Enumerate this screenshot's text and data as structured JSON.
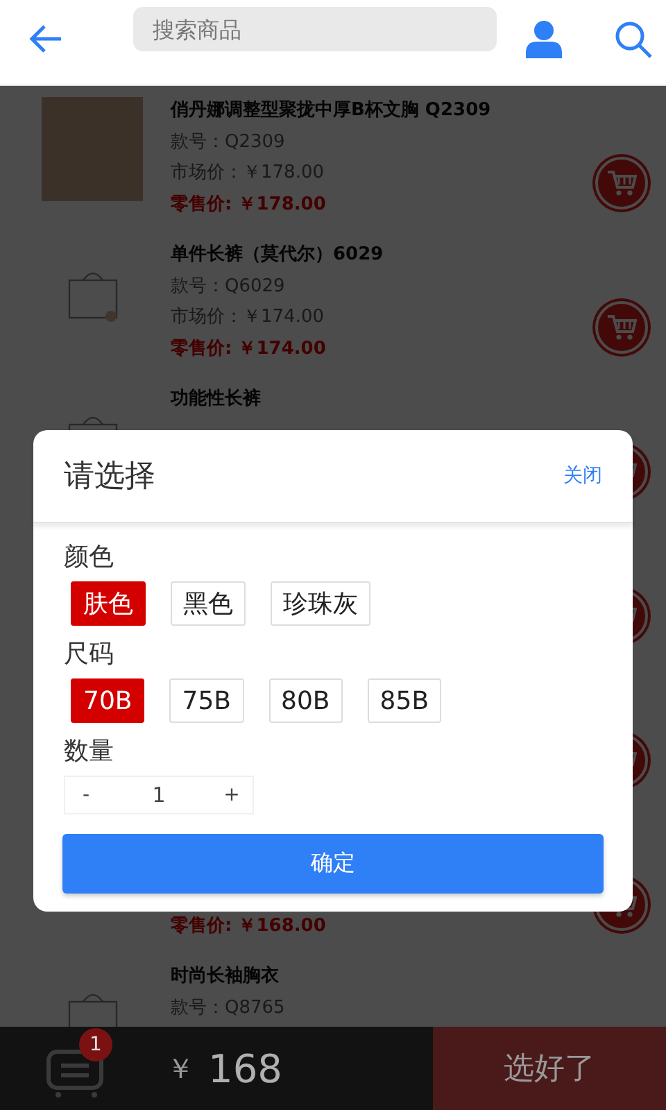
{
  "header": {
    "search": {
      "placeholder": "搜索商品"
    }
  },
  "products": [
    {
      "kind": "photo",
      "title": "俏丹娜调整型聚拢中厚B杯文胸 Q2309",
      "style_no": "款号：Q2309",
      "market_price": "市场价：￥178.00",
      "retail_price": "零售价: ￥178.00",
      "cart_button": true
    },
    {
      "kind": "bag",
      "title": "单件长裤（莫代尔）6029",
      "style_no": "款号：Q6029",
      "market_price": "市场价：￥174.00",
      "retail_price": "零售价: ￥174.00",
      "cart_button": true
    },
    {
      "kind": "bag",
      "title": "功能性长裤",
      "cart_button": true
    },
    {
      "kind": "none",
      "cart_button": true
    },
    {
      "kind": "none",
      "cart_button": true
    },
    {
      "kind": "none",
      "retail_price": "零售价: ￥168.00",
      "cart_button": true
    },
    {
      "kind": "bag",
      "title": "时尚长袖胸衣",
      "style_no": "款号：Q8765",
      "cart_button": false
    }
  ],
  "dialog": {
    "title": "请选择",
    "close": "关闭",
    "groups": [
      {
        "label": "颜色",
        "options": [
          {
            "label": "肤色",
            "selected": true
          },
          {
            "label": "黑色",
            "selected": false
          },
          {
            "label": "珍珠灰",
            "selected": false
          }
        ]
      },
      {
        "label": "尺码",
        "options": [
          {
            "label": "70B",
            "selected": true
          },
          {
            "label": "75B",
            "selected": false
          },
          {
            "label": "80B",
            "selected": false
          },
          {
            "label": "85B",
            "selected": false
          }
        ]
      }
    ],
    "quantity": {
      "label": "数量",
      "minus": "-",
      "value": "1",
      "plus": "+"
    },
    "confirm": "确定"
  },
  "bottom_bar": {
    "badge": "1",
    "currency": "￥",
    "total": "168",
    "checkout": "选好了"
  }
}
